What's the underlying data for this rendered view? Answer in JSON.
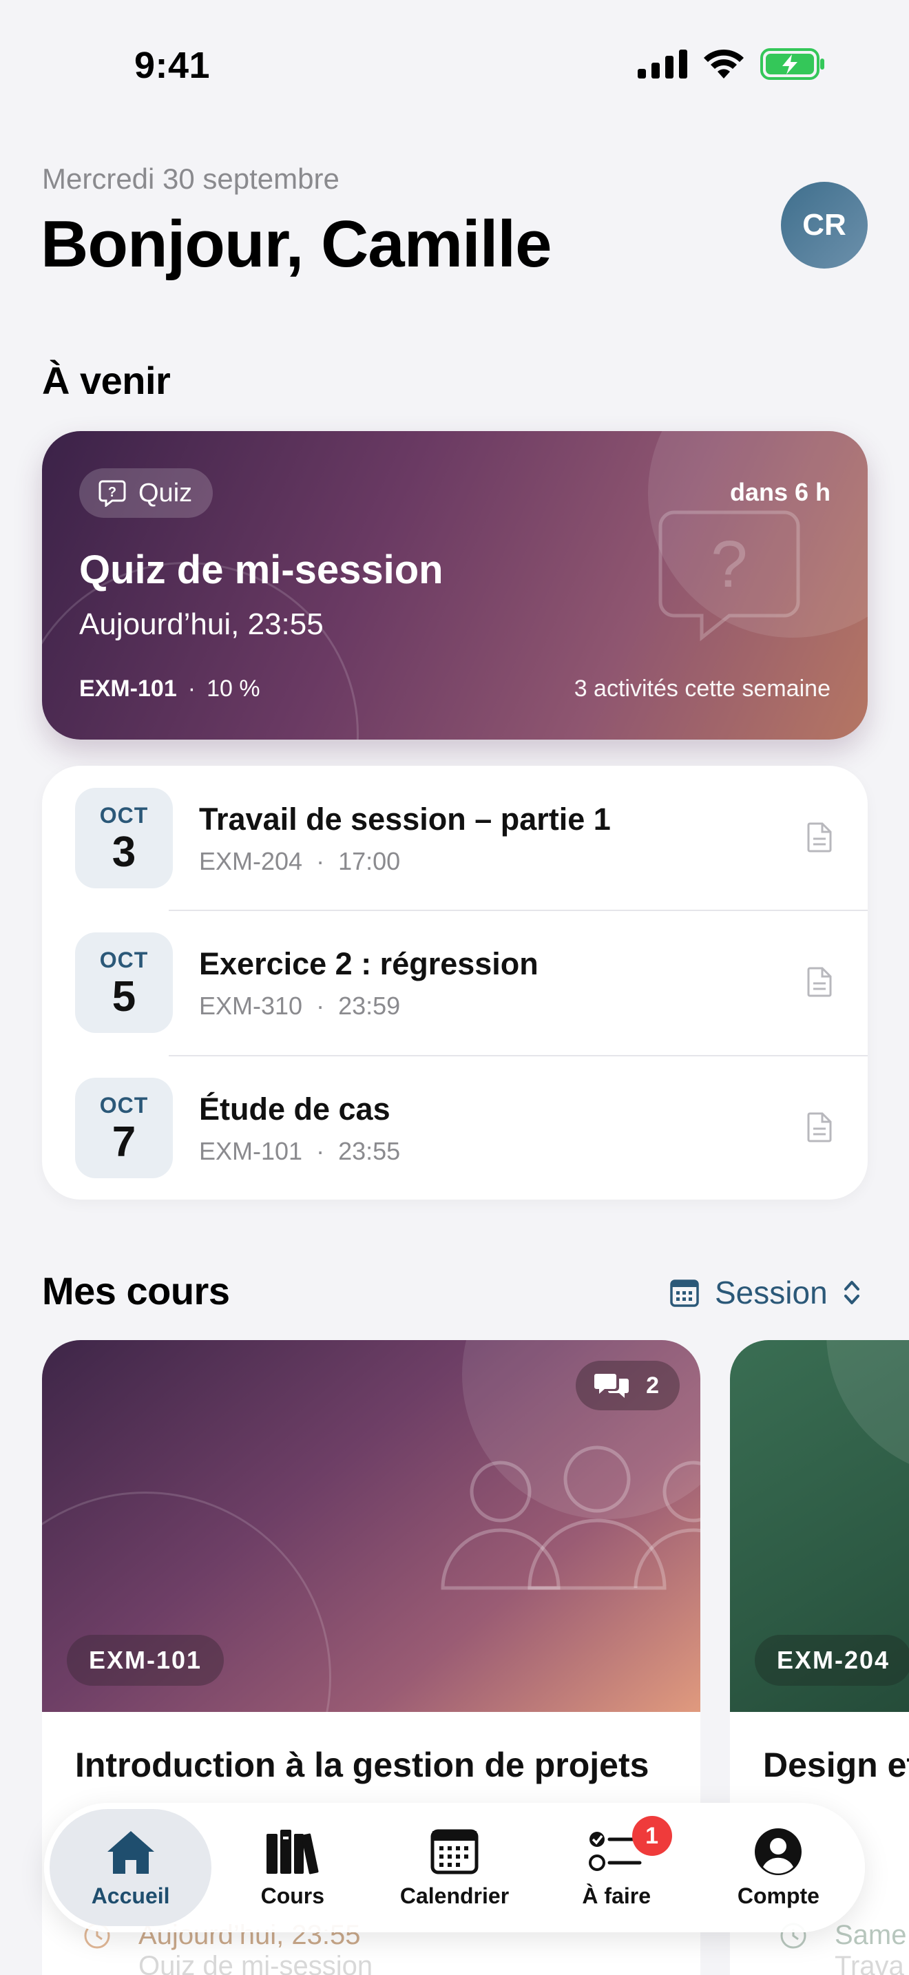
{
  "status_bar": {
    "time": "9:41"
  },
  "header": {
    "date": "Mercredi 30 septembre",
    "greeting": "Bonjour, Camille",
    "avatar_initials": "CR"
  },
  "upcoming": {
    "section_title": "À venir",
    "featured": {
      "type_label": "Quiz",
      "eta": "dans 6 h",
      "title": "Quiz de mi-session",
      "due": "Aujourd’hui, 23:55",
      "course_code": "EXM-101",
      "separator": "·",
      "weight": "10 %",
      "week_count": "3 activités cette semaine"
    },
    "items": [
      {
        "month": "OCT",
        "day": "3",
        "title": "Travail de session – partie 1",
        "course": "EXM-204",
        "time": "17:00"
      },
      {
        "month": "OCT",
        "day": "5",
        "title": "Exercice 2 : régression",
        "course": "EXM-310",
        "time": "23:59"
      },
      {
        "month": "OCT",
        "day": "7",
        "title": "Étude de cas",
        "course": "EXM-101",
        "time": "23:55"
      }
    ]
  },
  "courses": {
    "section_title": "Mes cours",
    "filter_label": "Session",
    "cards": [
      {
        "code": "EXM-101",
        "title": "Introduction à la gestion de projets",
        "messages": "2",
        "peek_due": "Aujourd’hui, 23:55",
        "peek_item": "Quiz de mi-session"
      },
      {
        "code": "EXM-204",
        "title": "Design et",
        "peek_due": "Same",
        "peek_item": "Trava"
      }
    ]
  },
  "tabbar": {
    "tabs": [
      {
        "label": "Accueil",
        "icon": "home-icon",
        "active": true
      },
      {
        "label": "Cours",
        "icon": "books-icon"
      },
      {
        "label": "Calendrier",
        "icon": "calendar-icon"
      },
      {
        "label": "À faire",
        "icon": "checklist-icon",
        "badge": "1"
      },
      {
        "label": "Compte",
        "icon": "account-icon"
      }
    ]
  },
  "colors": {
    "accent": "#2b5878",
    "badge": "#ef3b3b",
    "background": "#f4f4f7",
    "battery": "#34c759"
  }
}
